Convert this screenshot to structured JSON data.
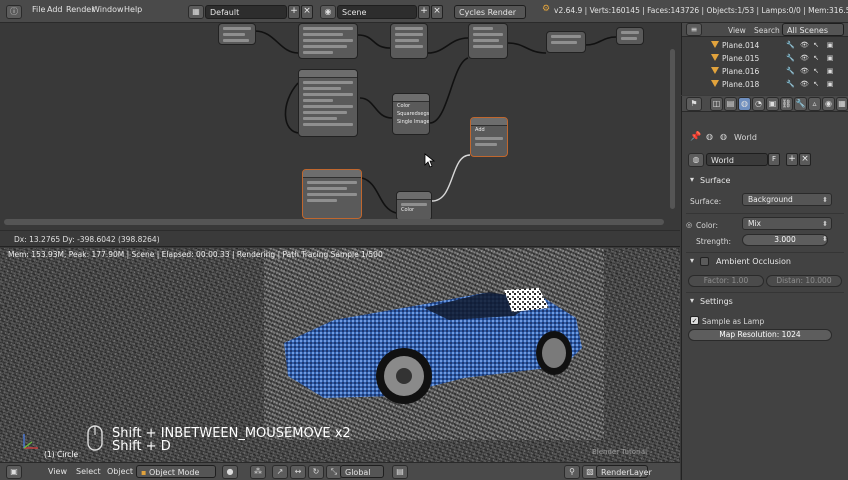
{
  "topbar": {
    "info_icon": "info-icon",
    "menus": [
      "File",
      "Add",
      "Render",
      "Window",
      "Help"
    ],
    "screen_layout": "Default",
    "scene": "Scene",
    "engine": "Cycles Render",
    "version_stats": "v2.64.9 | Verts:160145 | Faces:143726 | Objects:1/53 | Lamps:0/0 | Mem:316.59M (51"
  },
  "node_editor": {
    "node_texts": [
      "Color",
      "Squaredsegs",
      "Single Image",
      "Add",
      "Color"
    ],
    "status": "Dx: 13.2765  Dy: -398.6042 (398.8264)"
  },
  "viewport": {
    "render_info": "Mem: 153.93M, Peak: 177.90M | Scene | Elapsed: 00:00.33 | Rendering | Path Tracing Sample 1/500",
    "key_line1": "Shift + INBETWEEN_MOUSEMOVE x2",
    "key_line2": "Shift + D",
    "object_label": "(1) Circle",
    "watermark": "Blender Tutorial",
    "render_subject": "Blue sports car rendered in Cycles"
  },
  "bottombar": {
    "menus": [
      "View",
      "Select",
      "Object"
    ],
    "mode": "Object Mode",
    "orientation": "Global",
    "render_layer": "RenderLayer"
  },
  "outliner": {
    "view_label": "View",
    "search_label": "Search",
    "scenes_dropdown": "All Scenes",
    "items": [
      "Plane.014",
      "Plane.015",
      "Plane.016",
      "Plane.018"
    ]
  },
  "properties": {
    "context_label": "World",
    "world_name": "World",
    "fake_user": "F",
    "surface": {
      "header": "Surface",
      "surface_label": "Surface:",
      "surface_value": "Background",
      "color_label": "Color:",
      "color_value": "Mix",
      "strength_label": "Strength:",
      "strength_value": "3.000"
    },
    "ambient_occlusion": {
      "header": "Ambient Occlusion",
      "factor": "Factor: 1.00",
      "distance": "Distan: 10.000",
      "enabled": false
    },
    "settings": {
      "header": "Settings",
      "sample_as_lamp": "Sample as Lamp",
      "map_resolution": "Map Resolution: 1024",
      "sample_as_lamp_enabled": true
    }
  },
  "colors": {
    "socket_yellow": "#c7c729",
    "node_selected": "#c0672e",
    "car_blue": "#3d6fc4"
  }
}
